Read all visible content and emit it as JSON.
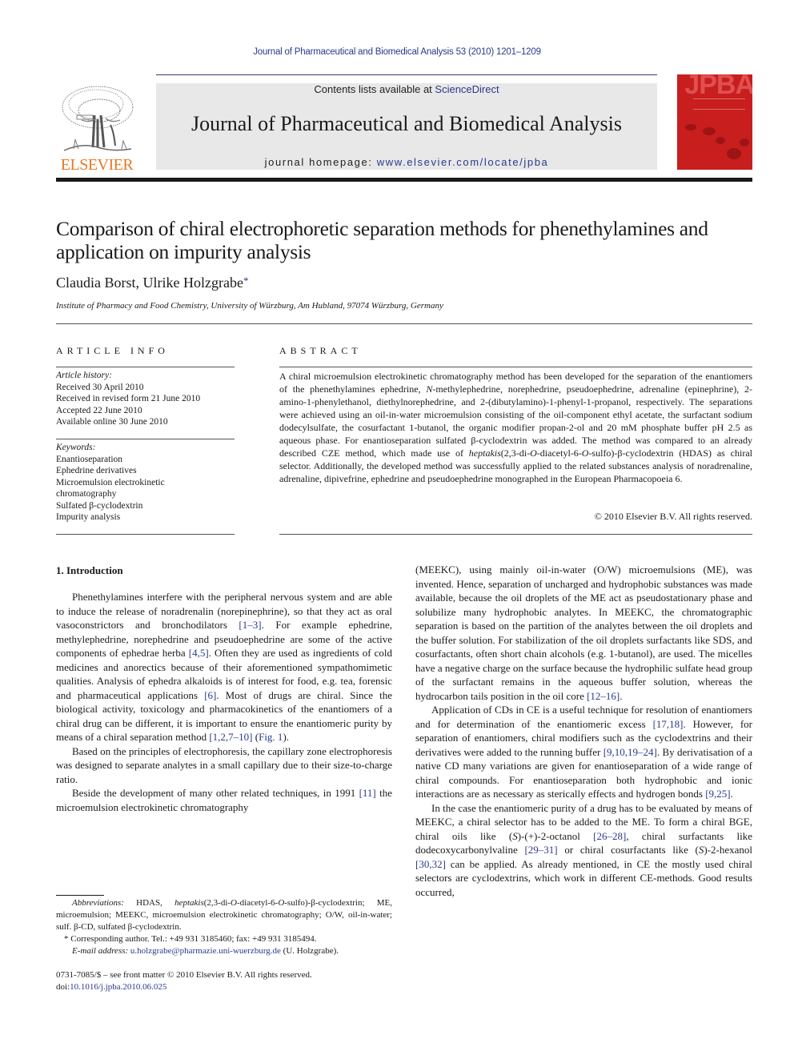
{
  "running_head": "Journal of Pharmaceutical and Biomedical Analysis 53 (2010) 1201–1209",
  "publisher": {
    "logo_word": "ELSEVIER",
    "logo_color": "#e87722"
  },
  "masthead": {
    "contents_prefix": "Contents lists available at ",
    "contents_link": "ScienceDirect",
    "journal_title": "Journal of Pharmaceutical and Biomedical Analysis",
    "homepage_prefix": "journal homepage: ",
    "homepage_link": "www.elsevier.com/locate/jpba"
  },
  "cover": {
    "acronym": "JPBA",
    "color": "#c81e1e"
  },
  "article": {
    "title": "Comparison of chiral electrophoretic separation methods for phenethylamines and application on impurity analysis",
    "authors": "Claudia Borst, Ulrike Holzgrabe",
    "corresponding_mark": "*",
    "affiliation": "Institute of Pharmacy and Food Chemistry, University of Würzburg, Am Hubland, 97074 Würzburg, Germany"
  },
  "article_info": {
    "heading": "ARTICLE INFO",
    "history_label": "Article history:",
    "history": [
      "Received 30 April 2010",
      "Received in revised form 21 June 2010",
      "Accepted 22 June 2010",
      "Available online 30 June 2010"
    ],
    "keywords_label": "Keywords:",
    "keywords": [
      "Enantioseparation",
      "Ephedrine derivatives",
      "Microemulsion electrokinetic chromatography",
      "Sulfated β-cyclodextrin",
      "Impurity analysis"
    ]
  },
  "abstract": {
    "heading": "ABSTRACT",
    "text_1": "A chiral microemulsion electrokinetic chromatography method has been developed for the separation of the enantiomers of the phenethylamines ephedrine, ",
    "text_italic_1": "N",
    "text_2": "-methylephedrine, norephedrine, pseudoephedrine, adrenaline (epinephrine), 2-amino-1-phenylethanol, diethylnorephedrine, and 2-(dibutylamino)-1-phenyl-1-propanol, respectively. The separations were achieved using an oil-in-water microemulsion consisting of the oil-component ethyl acetate, the surfactant sodium dodecylsulfate, the cosurfactant 1-butanol, the organic modifier propan-2-ol and 20 mM phosphate buffer pH 2.5 as aqueous phase. For enantioseparation sulfated β-cyclodextrin was added. The method was compared to an already described CZE method, which made use of ",
    "text_italic_2": "heptakis",
    "text_3": "(2,3-di-",
    "text_italic_3": "O",
    "text_4": "-diacetyl-6-",
    "text_italic_4": "O",
    "text_5": "-sulfo)-β-cyclodextrin (HDAS) as chiral selector. Additionally, the developed method was successfully applied to the related substances analysis of noradrenaline, adrenaline, dipivefrine, ephedrine and pseudoephedrine monographed in the European Pharmacopoeia 6.",
    "copyright": "© 2010 Elsevier B.V. All rights reserved."
  },
  "intro": {
    "heading": "1.  Introduction",
    "p1": [
      "Phenethylamines interfere with the peripheral nervous system and are able to induce the release of noradrenalin (norepinephrine), so that they act as oral vasoconstrictors and bronchodilators ",
      "[1–3]",
      ". For example ephedrine, methylephedrine, norephedrine and pseudoephedrine are some of the active components of ephedrae herba ",
      "[4,5]",
      ". Often they are used as ingredients of cold medicines and anorectics because of their aforementioned sympathomimetic qualities. Analysis of ephedra alkaloids is of interest for food, e.g. tea, forensic and pharmaceutical applications ",
      "[6]",
      ". Most of drugs are chiral. Since the biological activity, toxicology and pharmacokinetics of the enantiomers of a chiral drug can be different, it is important to ensure the enantiomeric purity by means of a chiral separation method ",
      "[1,2,7–10]",
      " (",
      "Fig. 1",
      ")."
    ],
    "p2": "Based on the principles of electrophoresis, the capillary zone electrophoresis was designed to separate analytes in a small capillary due to their size-to-charge ratio.",
    "p3": [
      "Beside the development of many other related techniques, in 1991 ",
      "[11]",
      " the microemulsion electrokinetic chromatography"
    ],
    "p3_cont": [
      "(MEEKC), using mainly oil-in-water (O/W) microemulsions (ME), was invented. Hence, separation of uncharged and hydrophobic substances was made available, because the oil droplets of the ME act as pseudostationary phase and solubilize many hydrophobic analytes. In MEEKC, the chromatographic separation is based on the partition of the analytes between the oil droplets and the buffer solution. For stabilization of the oil droplets surfactants like SDS, and cosurfactants, often short chain alcohols (e.g. 1-butanol), are used. The micelles have a negative charge on the surface because the hydrophilic sulfate head group of the surfactant remains in the aqueous buffer solution, whereas the hydrocarbon tails position in the oil core ",
      "[12–16]",
      "."
    ],
    "p4": [
      "Application of CDs in CE is a useful technique for resolution of enantiomers and for determination of the enantiomeric excess ",
      "[17,18]",
      ". However, for separation of enantiomers, chiral modifiers such as the cyclodextrins and their derivatives were added to the running buffer ",
      "[9,10,19–24]",
      ". By derivatisation of a native CD many variations are given for enantioseparation of a wide range of chiral compounds. For enantioseparation both hydrophobic and ionic interactions are as necessary as sterically effects and hydrogen bonds ",
      "[9,25]",
      "."
    ],
    "p5": [
      "In the case the enantiomeric purity of a drug has to be evaluated by means of MEEKC, a chiral selector has to be added to the ME. To form a chiral BGE, chiral oils like (",
      "S",
      ")-(+)-2-octanol ",
      "[26–28]",
      ", chiral surfactants like dodecoxycarbonylvaline ",
      "[29–31]",
      " or chiral cosurfactants like (",
      "S",
      ")-2-hexanol ",
      "[30,32]",
      " can be applied. As already mentioned, in CE the mostly used chiral selectors are cyclodextrins, which work in different CE-methods. Good results occurred,"
    ]
  },
  "footnotes": {
    "abbrev_label": "Abbreviations:",
    "abbrev_1": "  HDAS, ",
    "abbrev_it": "heptakis",
    "abbrev_2": "(2,3-di-",
    "abbrev_o1": "O",
    "abbrev_3": "-diacetyl-6-",
    "abbrev_o2": "O",
    "abbrev_4": "-sulfo)-β-cyclodextrin; ME, microemulsion; MEEKC, microemulsion electrokinetic chromatography; O/W, oil-in-water; sulf. β-CD, sulfated β-cyclodextrin.",
    "corresponding": "* Corresponding author. Tel.: +49 931 3185460; fax: +49 931 3185494.",
    "email_label": "E-mail address: ",
    "email": "u.holzgrabe@pharmazie.uni-wuerzburg.de",
    "email_suffix": " (U. Holzgrabe)."
  },
  "imprint": {
    "issn_line": "0731-7085/$ – see front matter © 2010 Elsevier B.V. All rights reserved.",
    "doi_prefix": "doi:",
    "doi": "10.1016/j.jpba.2010.06.025"
  }
}
